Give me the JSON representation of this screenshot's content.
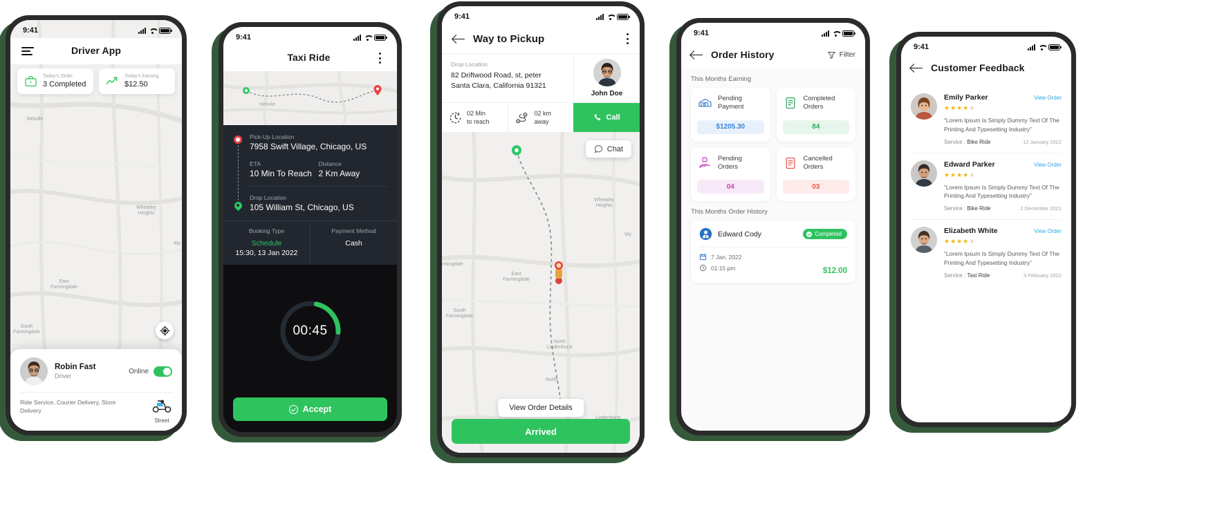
{
  "statusbar": {
    "time": "9:41"
  },
  "phone1": {
    "title": "Driver App",
    "menu_icon": "hamburger-icon",
    "stats": [
      {
        "label": "Today's Order",
        "value": "3 Completed",
        "icon": "briefcase-icon",
        "color": "#2fc35f"
      },
      {
        "label": "Today's Earning",
        "value": "$12.50",
        "icon": "trending-up-icon",
        "color": "#2fc35f"
      }
    ],
    "map_labels": [
      "Melville",
      "Wheatley Heights",
      "East Farmingdale",
      "South Farmingdale",
      "Wyandanch"
    ],
    "locate_icon": "crosshair-icon",
    "driver": {
      "name": "Robin Fast",
      "role": "Driver",
      "online_label": "Online",
      "online": true,
      "services": "Ride Service, Courier Delivery, Store Delivery",
      "vehicle_label": "Street",
      "vehicle_icon": "scooter-icon"
    }
  },
  "phone2": {
    "title": "Taxi Ride",
    "menu_icon": "kebab-icon",
    "pickup": {
      "label": "Pick-Up Location",
      "value": "7958 Swift Village, Chicago, US"
    },
    "drop": {
      "label": "Drop Location",
      "value": "105 William St, Chicago, US"
    },
    "eta": {
      "label": "ETA",
      "value": "10 Min To Reach"
    },
    "distance": {
      "label": "Distance",
      "value": "2 Km Away"
    },
    "booking": {
      "label": "Booking Type",
      "value": "Schedule",
      "sub": "15:30, 13 Jan 2022"
    },
    "payment": {
      "label": "Payment Method",
      "value": "Cash"
    },
    "timer": "00:45",
    "timer_progress_pct": 22,
    "accept_label": "Accept",
    "accept_color": "#2fc35f"
  },
  "phone3": {
    "title": "Way to Pickup",
    "menu_icon": "kebab-icon",
    "drop": {
      "label": "Drop Location",
      "line1": "82  Driftwood Road, st, peter",
      "line2": "Santa Clara, California 91321"
    },
    "user": {
      "name": "John Doe"
    },
    "time_cell": {
      "line1": "02 Min",
      "line2": "to reach",
      "icon": "clock-icon"
    },
    "dist_cell": {
      "line1": "02 km",
      "line2": "away",
      "icon": "route-icon"
    },
    "call_label": "Call",
    "call_icon": "phone-icon",
    "chat_label": "Chat",
    "chat_icon": "chat-bubble-icon",
    "view_order_label": "View Order Details",
    "arrived_label": "Arrived",
    "map_labels": [
      "Wheatley Heights",
      "Wyandanch",
      "East Farmingdale",
      "South Farmingdale",
      "North Lindenhurst",
      "North",
      "Lindenhurst",
      "Farmingdale"
    ]
  },
  "phone4": {
    "title": "Order History",
    "filter_label": "Filter",
    "filter_icon": "funnel-icon",
    "earning_section": "This Months Earning",
    "cards": [
      {
        "label": "Pending Payment",
        "value": "$1205.30",
        "icon": "money-icon",
        "color": "#3b82d6",
        "bg": "#e8f1fb"
      },
      {
        "label": "Completed Orders",
        "value": "84",
        "icon": "document-check-icon",
        "color": "#2fa862",
        "bg": "#e7f6ec"
      },
      {
        "label": "Pending Orders",
        "value": "04",
        "icon": "handshake-icon",
        "color": "#c445c4",
        "bg": "#f8e9f8"
      },
      {
        "label": "Cancelled Orders",
        "value": "03",
        "icon": "document-cancel-icon",
        "color": "#e8544a",
        "bg": "#fdeceb"
      }
    ],
    "history_section": "This Months Order History",
    "order": {
      "name": "Edward Cody",
      "status": "Completed",
      "date": "7 Jan, 2022",
      "time": "01:15 pm",
      "price": "$12.00",
      "date_icon": "calendar-icon",
      "time_icon": "clock-icon"
    }
  },
  "phone5": {
    "title": "Customer Feedback",
    "view_order_label": "View Order",
    "feedback": [
      {
        "name": "Emily Parker",
        "stars": 4,
        "text": "“Lorem Ipsum Is Simply Dummy Text Of The Printing And Typesetting Industry”",
        "service_label": "Service :",
        "service": "Bike Ride",
        "date": "12 January 2022"
      },
      {
        "name": "Edward Parker",
        "stars": 4,
        "text": "“Lorem Ipsum Is Simply Dummy Text Of The Printing And Typesetting Industry”",
        "service_label": "Service :",
        "service": "Bike Ride",
        "date": "2 December 2021"
      },
      {
        "name": "Elizabeth White",
        "stars": 4,
        "text": "“Lorem Ipsum Is Simply Dummy Text Of The Printing And Typesetting Industry”",
        "service_label": "Service :",
        "service": "Taxi Ride",
        "date": "3 February 2022"
      }
    ]
  }
}
